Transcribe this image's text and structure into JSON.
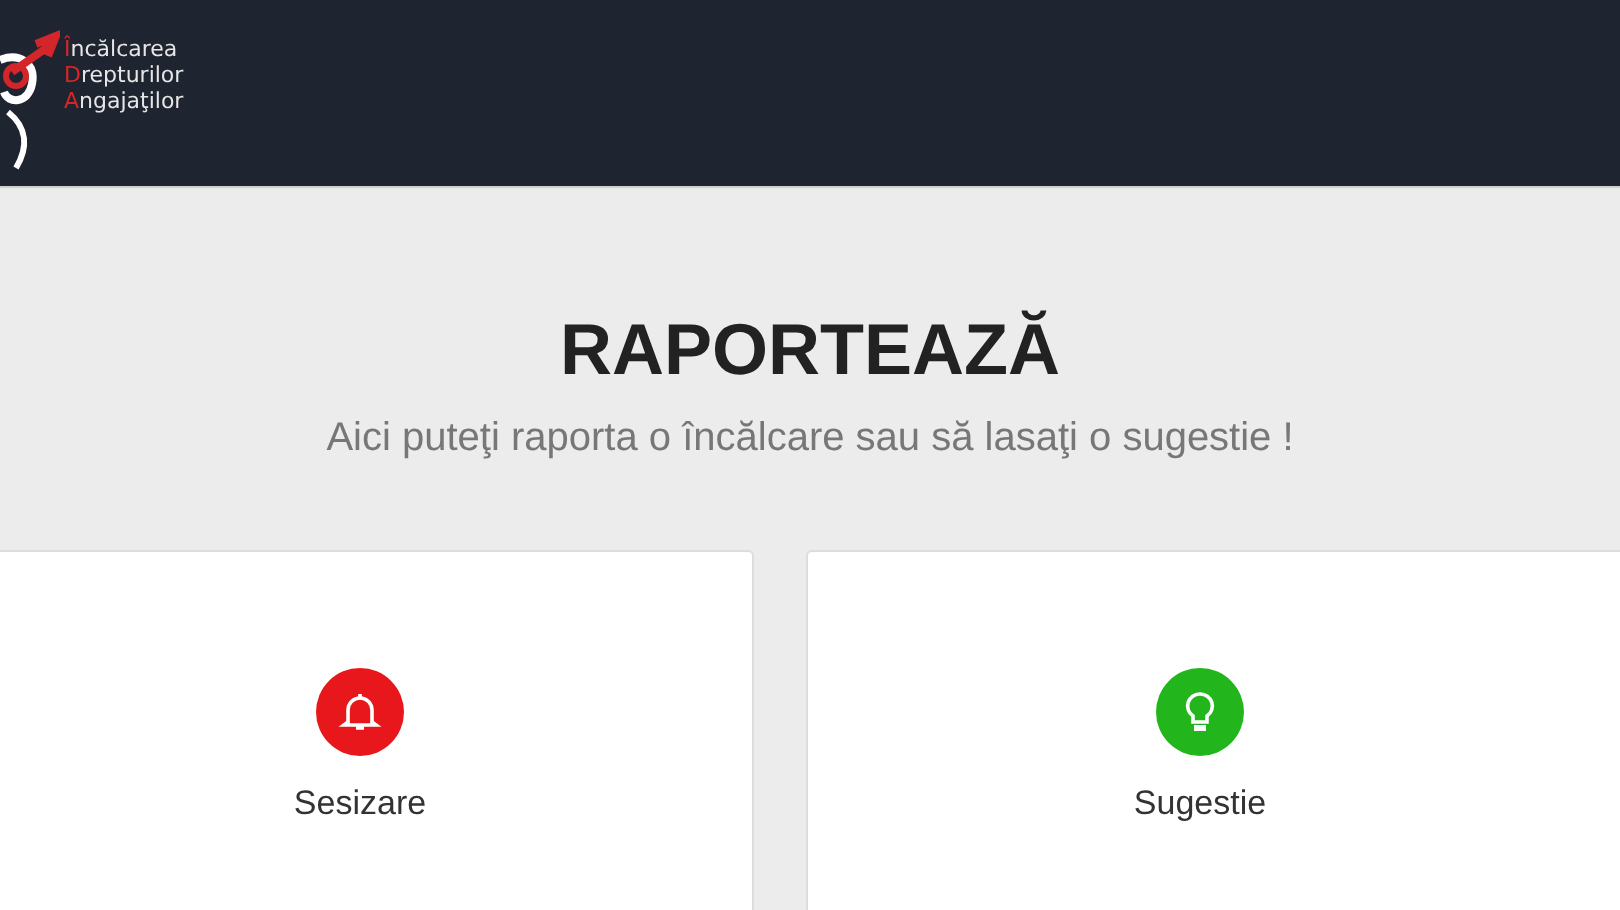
{
  "logo": {
    "lines": [
      {
        "initial": "Î",
        "rest": "ncălcarea"
      },
      {
        "initial": "D",
        "rest": "repturilor"
      },
      {
        "initial": "A",
        "rest": "ngajaţilor"
      }
    ]
  },
  "hero": {
    "title": "RAPORTEAZĂ",
    "subtitle": "Aici puteţi raporta o încălcare sau să lasaţi o sugestie !"
  },
  "cards": [
    {
      "kind": "bell",
      "label": "Sesizare",
      "color": "#e8171b"
    },
    {
      "kind": "bulb",
      "label": "Sugestie",
      "color": "#22b51c"
    }
  ]
}
